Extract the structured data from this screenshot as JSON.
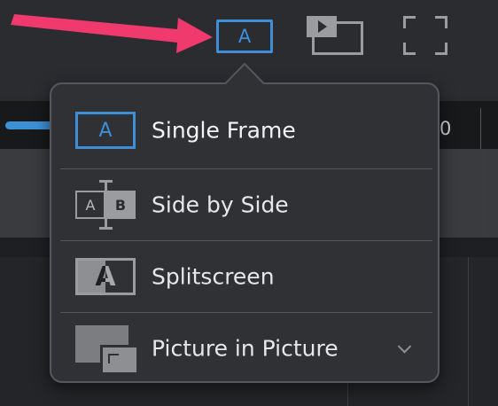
{
  "toolbar": {
    "single_frame_glyph": "A"
  },
  "timeline": {
    "ruler_value": "0"
  },
  "view_menu": {
    "items": [
      {
        "label": "Single Frame",
        "icon": "single-frame-icon",
        "glyph": "A",
        "selected": true
      },
      {
        "label": "Side by Side",
        "icon": "side-by-side-icon",
        "glyph_a": "A",
        "glyph_b": "B"
      },
      {
        "label": "Splitscreen",
        "icon": "splitscreen-icon",
        "glyph": "A"
      },
      {
        "label": "Picture in Picture",
        "icon": "picture-in-picture-icon",
        "has_dropdown": true
      }
    ]
  },
  "colors": {
    "accent": "#3e8ed8",
    "annotation_arrow": "#f0396c",
    "menu_background": "#303135",
    "menu_text": "#e6e7ea",
    "icon_gray": "#9b9ca0"
  }
}
